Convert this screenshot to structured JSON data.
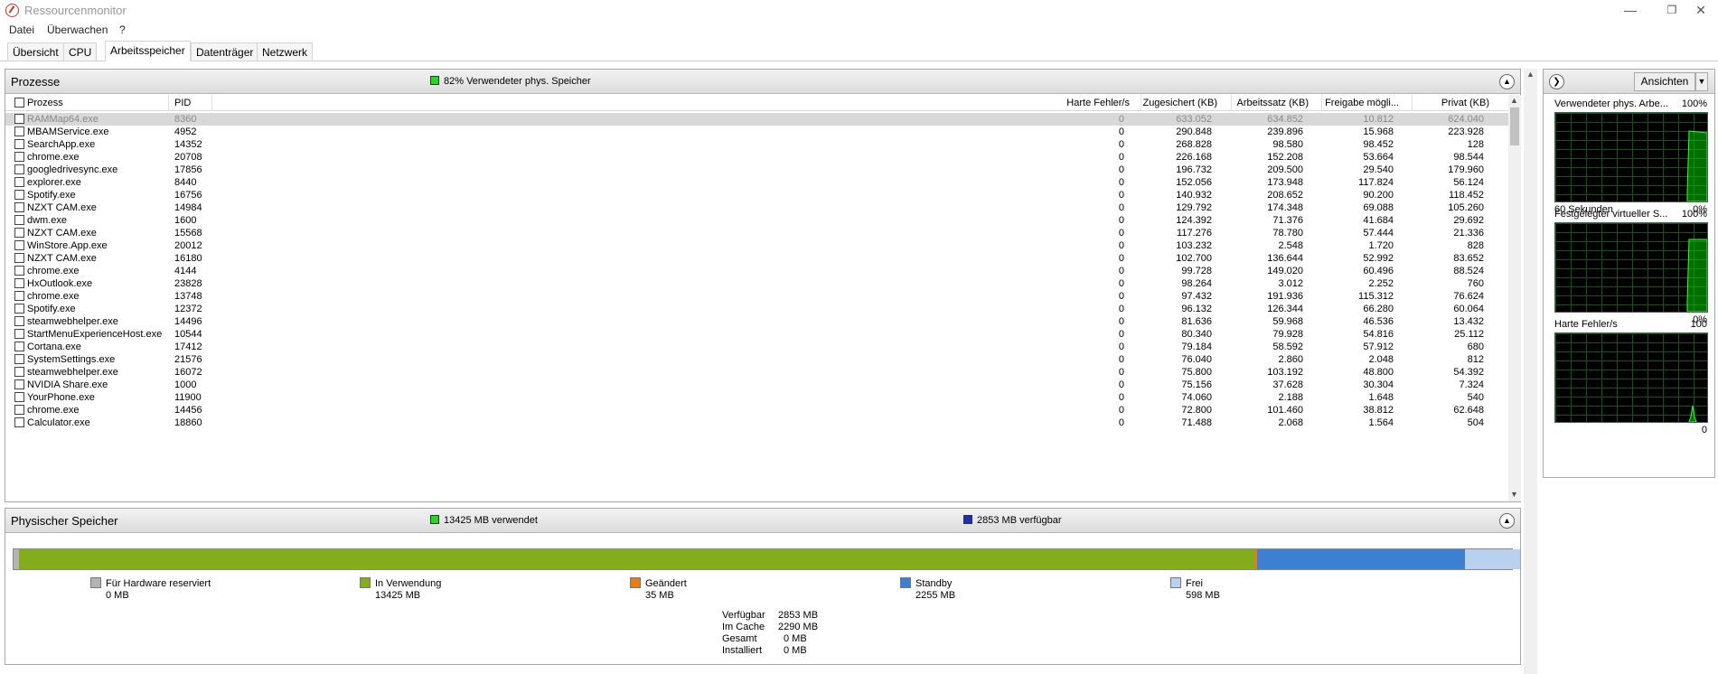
{
  "window": {
    "title": "Ressourcenmonitor"
  },
  "menu": [
    "Datei",
    "Überwachen",
    "?"
  ],
  "tabs": [
    {
      "label": "Übersicht"
    },
    {
      "label": "CPU"
    },
    {
      "label": "Arbeitsspeicher",
      "active": true
    },
    {
      "label": "Datenträger"
    },
    {
      "label": "Netzwerk"
    }
  ],
  "processes": {
    "title": "Prozesse",
    "legend": "82% Verwendeter phys. Speicher",
    "legend_color": "#1fdc1f",
    "columns": [
      "Prozess",
      "PID",
      "Harte Fehler/s",
      "Zugesichert (KB)",
      "Arbeitssatz (KB)",
      "Freigabe mögli...",
      "Privat (KB)"
    ],
    "rows": [
      [
        "RAMMap64.exe",
        "8360",
        "0",
        "633.052",
        "634.852",
        "10.812",
        "624.040"
      ],
      [
        "MBAMService.exe",
        "4952",
        "0",
        "290.848",
        "239.896",
        "15.968",
        "223.928"
      ],
      [
        "SearchApp.exe",
        "14352",
        "0",
        "268.828",
        "98.580",
        "98.452",
        "128"
      ],
      [
        "chrome.exe",
        "20708",
        "0",
        "226.168",
        "152.208",
        "53.664",
        "98.544"
      ],
      [
        "googledrivesync.exe",
        "17856",
        "0",
        "196.732",
        "209.500",
        "29.540",
        "179.960"
      ],
      [
        "explorer.exe",
        "8440",
        "0",
        "152.056",
        "173.948",
        "117.824",
        "56.124"
      ],
      [
        "Spotify.exe",
        "16756",
        "0",
        "140.932",
        "208.652",
        "90.200",
        "118.452"
      ],
      [
        "NZXT CAM.exe",
        "14984",
        "0",
        "129.792",
        "174.348",
        "69.088",
        "105.260"
      ],
      [
        "dwm.exe",
        "1600",
        "0",
        "124.392",
        "71.376",
        "41.684",
        "29.692"
      ],
      [
        "NZXT CAM.exe",
        "15568",
        "0",
        "117.276",
        "78.780",
        "57.444",
        "21.336"
      ],
      [
        "WinStore.App.exe",
        "20012",
        "0",
        "103.232",
        "2.548",
        "1.720",
        "828"
      ],
      [
        "NZXT CAM.exe",
        "16180",
        "0",
        "102.700",
        "136.644",
        "52.992",
        "83.652"
      ],
      [
        "chrome.exe",
        "4144",
        "0",
        "99.728",
        "149.020",
        "60.496",
        "88.524"
      ],
      [
        "HxOutlook.exe",
        "23828",
        "0",
        "98.264",
        "3.012",
        "2.252",
        "760"
      ],
      [
        "chrome.exe",
        "13748",
        "0",
        "97.432",
        "191.936",
        "115.312",
        "76.624"
      ],
      [
        "Spotify.exe",
        "12372",
        "0",
        "96.132",
        "126.344",
        "66.280",
        "60.064"
      ],
      [
        "steamwebhelper.exe",
        "14496",
        "0",
        "81.636",
        "59.968",
        "46.536",
        "13.432"
      ],
      [
        "StartMenuExperienceHost.exe",
        "10544",
        "0",
        "80.340",
        "79.928",
        "54.816",
        "25.112"
      ],
      [
        "Cortana.exe",
        "17412",
        "0",
        "79.184",
        "58.592",
        "57.912",
        "680"
      ],
      [
        "SystemSettings.exe",
        "21576",
        "0",
        "76.040",
        "2.860",
        "2.048",
        "812"
      ],
      [
        "steamwebhelper.exe",
        "16072",
        "0",
        "75.800",
        "103.192",
        "48.800",
        "54.392"
      ],
      [
        "NVIDIA Share.exe",
        "1000",
        "0",
        "75.156",
        "37.628",
        "30.304",
        "7.324"
      ],
      [
        "YourPhone.exe",
        "11900",
        "0",
        "74.060",
        "2.188",
        "1.648",
        "540"
      ],
      [
        "chrome.exe",
        "14456",
        "0",
        "72.800",
        "101.460",
        "38.812",
        "62.648"
      ],
      [
        "Calculator.exe",
        "18860",
        "0",
        "71.488",
        "2.068",
        "1.564",
        "504"
      ]
    ]
  },
  "physical": {
    "title": "Physischer Speicher",
    "used_legend": "13425 MB verwendet",
    "used_color": "#1fdc1f",
    "avail_legend": "2853 MB verfügbar",
    "avail_color": "#1a2fb8",
    "bar_fractions": {
      "hardware": 0.0,
      "in_use": 0.8246,
      "modified": 0.0021,
      "standby": 0.1385,
      "free": 0.0367
    },
    "categories": [
      {
        "name": "Für Hardware reserviert",
        "value": "0 MB",
        "color": "#b4b4b4"
      },
      {
        "name": "In Verwendung",
        "value": "13425 MB",
        "color": "#84ad1c"
      },
      {
        "name": "Geändert",
        "value": "35 MB",
        "color": "#e47e14"
      },
      {
        "name": "Standby",
        "value": "2255 MB",
        "color": "#3c80d2"
      },
      {
        "name": "Frei",
        "value": "598 MB",
        "color": "#b9d0ef"
      }
    ],
    "summary": [
      {
        "label": "Verfügbar",
        "value": "2853 MB"
      },
      {
        "label": "Im Cache",
        "value": "2290 MB"
      },
      {
        "label": "Gesamt",
        "value": "0 MB"
      },
      {
        "label": "Installiert",
        "value": "0 MB"
      }
    ]
  },
  "side": {
    "views_button": "Ansichten",
    "graphs": [
      {
        "title": "Verwendeter phys. Arbe...",
        "max": "100%",
        "footer_left": "60 Sekunden",
        "footer_right": "0%"
      },
      {
        "title": "Festgelegter virtueller S...",
        "max": "100%",
        "footer_left": "",
        "footer_right": "0%"
      },
      {
        "title": "Harte Fehler/s",
        "max": "100",
        "footer_left": "",
        "footer_right": "0"
      }
    ]
  }
}
